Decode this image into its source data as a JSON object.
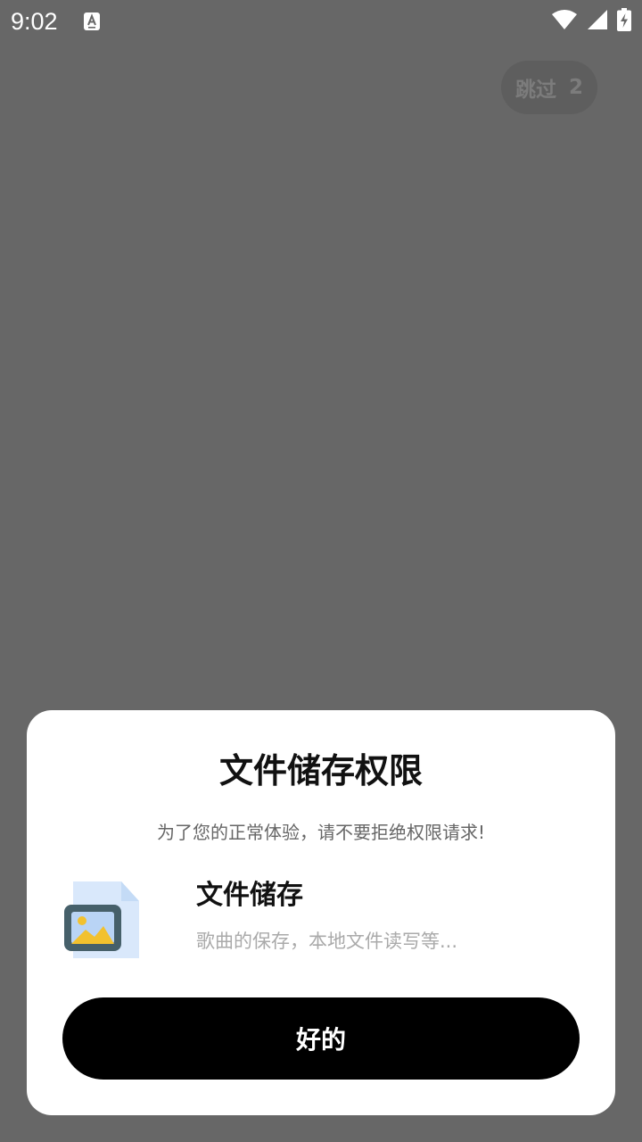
{
  "status_bar": {
    "time": "9:02",
    "icons": [
      "keyboard-a-icon",
      "wifi-icon",
      "cell-signal-icon",
      "battery-charging-icon"
    ]
  },
  "skip": {
    "label": "跳过",
    "countdown": "2"
  },
  "dialog": {
    "title": "文件储存权限",
    "subtitle": "为了您的正常体验，请不要拒绝权限请求!",
    "permission": {
      "icon": "file-image-icon",
      "name": "文件储存",
      "description": "歌曲的保存，本地文件读写等..."
    },
    "ok_label": "好的"
  },
  "colors": {
    "overlay": "#676767",
    "dialog_bg": "#ffffff",
    "button_bg": "#000000",
    "icon_folder": "#46606a",
    "icon_doc": "#d9e8fb",
    "icon_sun": "#f2c12e"
  }
}
